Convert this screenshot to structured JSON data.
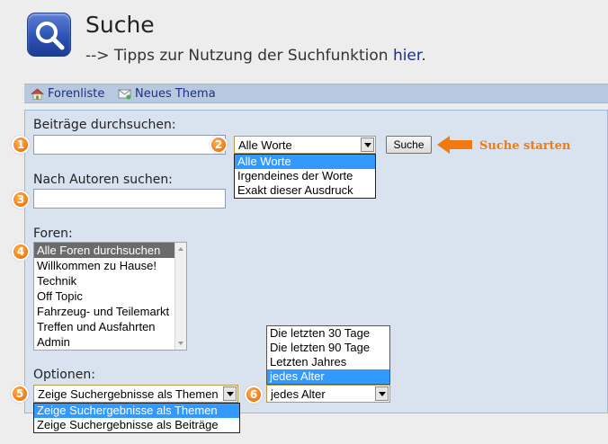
{
  "header": {
    "title": "Suche",
    "tips_prefix": "--> Tipps zur Nutzung der Suchfunktion ",
    "tips_link": "hier",
    "tips_suffix": "."
  },
  "nav": {
    "forum_list": "Forenliste",
    "new_topic": "Neues Thema"
  },
  "search": {
    "posts_label": "Beiträge durchsuchen:",
    "posts_value": "",
    "mode_selected": "Alle Worte",
    "mode_options": [
      "Alle Worte",
      "Irgendeines der Worte",
      "Exakt dieser Ausdruck"
    ],
    "submit_label": "Suche",
    "callout": "Suche starten",
    "authors_label": "Nach Autoren suchen:",
    "authors_value": ""
  },
  "forums": {
    "label": "Foren:",
    "items": [
      "Alle Foren durchsuchen",
      "Willkommen zu Hause!",
      "Technik",
      "Off Topic",
      "Fahrzeug- und Teilemarkt",
      "Treffen und Ausfahrten",
      "Admin"
    ]
  },
  "options": {
    "label": "Optionen:",
    "display_selected": "Zeige Suchergebnisse als Themen",
    "display_options": [
      "Zeige Suchergebnisse als Themen",
      "Zeige Suchergebnisse als Beiträge"
    ],
    "age_selected": "jedes Alter",
    "age_options": [
      "Die letzten 30 Tage",
      "Die letzten 90 Tage",
      "Letzten Jahres",
      "jedes Alter"
    ]
  },
  "badges": [
    "1",
    "2",
    "3",
    "4",
    "5",
    "6"
  ],
  "icons": {
    "logo": "magnifier-icon",
    "forum_list": "home-icon",
    "new_topic": "new-topic-icon",
    "callout": "arrow-left-icon"
  },
  "colors": {
    "accent_orange": "#f07a10",
    "selection_blue": "#3399ff",
    "link_blue": "#1a2f8a",
    "panel_bg": "#d9e3f0"
  }
}
